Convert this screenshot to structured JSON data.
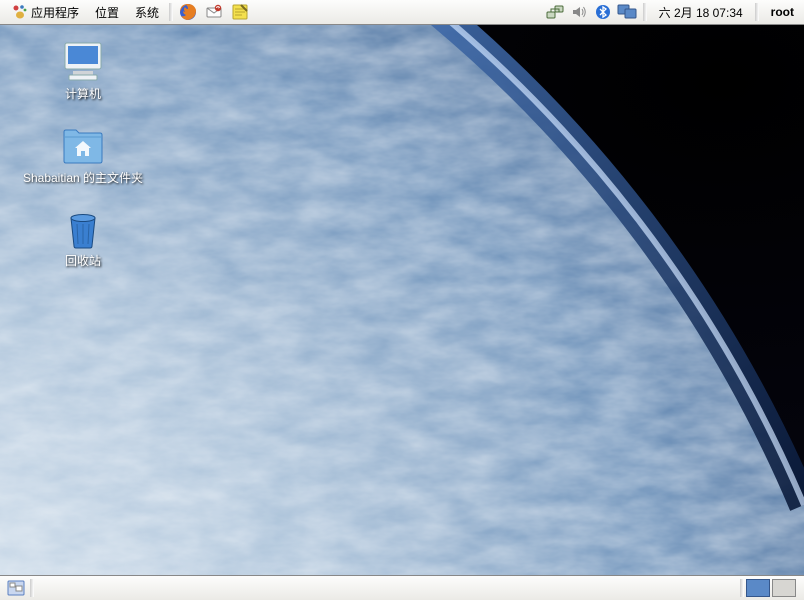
{
  "top_panel": {
    "menus": {
      "apps": "应用程序",
      "places": "位置",
      "system": "系统"
    },
    "tray": {
      "network_icon": "network-icon",
      "volume_icon": "volume-icon",
      "bluetooth_icon": "bluetooth-icon",
      "display_icon": "display-icon"
    },
    "clock": "六 2月  18 07:34",
    "user": "root"
  },
  "desktop": {
    "icons": [
      {
        "name": "computer",
        "label": "计算机"
      },
      {
        "name": "home",
        "label": "Shabaitian 的主文件夹"
      },
      {
        "name": "trash",
        "label": "回收站"
      }
    ]
  },
  "bottom_panel": {
    "workspaces": 2,
    "active_workspace": 0
  }
}
